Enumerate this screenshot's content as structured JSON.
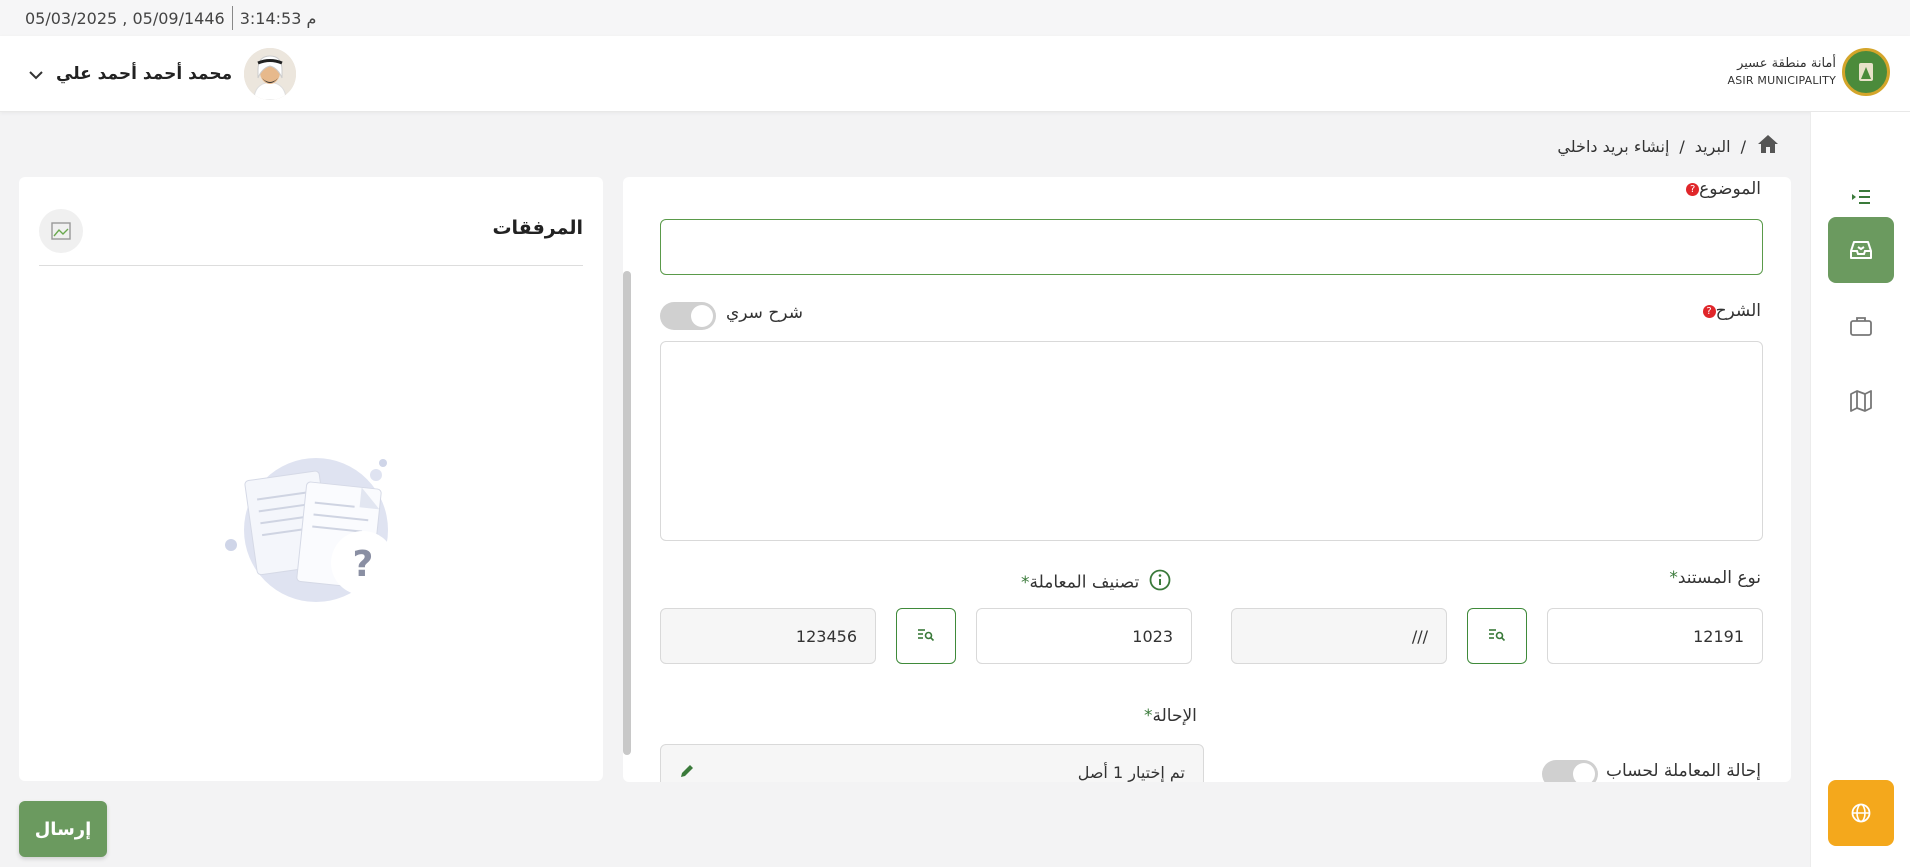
{
  "topbar": {
    "time": "3:14:53 م",
    "dates": "05/03/2025 , 05/09/1446"
  },
  "header": {
    "user_name": "محمد أحمد أحمد علي",
    "logo_ar": "أمانة منطقة عسير",
    "logo_en": "ASIR MUNICIPALITY"
  },
  "breadcrumb": {
    "home_icon": "home-icon",
    "mail": "البريد",
    "separator": "/",
    "current": "إنشاء بريد داخلي"
  },
  "form": {
    "subject_label": "الموضوع",
    "subject_value": "",
    "description_label": "الشرح",
    "secret_label": "شرح سري",
    "description_value": "",
    "doc_type_label": "نوع المستند",
    "doc_type_code": "12191",
    "doc_type_name": "///",
    "classification_label": "تصنيف المعاملة",
    "classification_code": "1023",
    "classification_name": "123456",
    "referral_label": "الإحالة",
    "referral_value": "تم إختيار 1 أصل",
    "account_referral_label": "إحالة المعاملة لحساب"
  },
  "attachments": {
    "title": "المرفقات"
  },
  "actions": {
    "send": "إرسال"
  },
  "colors": {
    "primary": "#6b9a5f",
    "accent": "#f4a81c",
    "required": "#e0262a"
  }
}
